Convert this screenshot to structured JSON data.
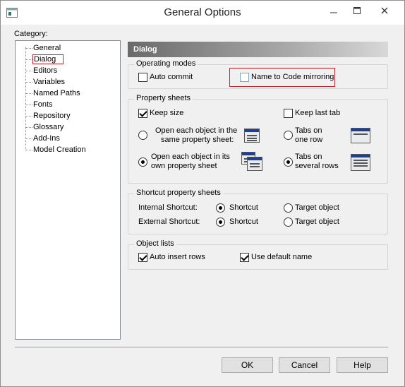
{
  "window": {
    "title": "General Options",
    "controls": {
      "minimize": "‒",
      "maximize": "☐",
      "close": "✕"
    }
  },
  "category": {
    "label": "Category:",
    "items": [
      "General",
      "Dialog",
      "Editors",
      "Variables",
      "Named Paths",
      "Fonts",
      "Repository",
      "Glossary",
      "Add-Ins",
      "Model Creation"
    ],
    "selected": "Dialog"
  },
  "panel": {
    "header": "Dialog",
    "operating_modes": {
      "title": "Operating modes",
      "auto_commit": {
        "label": "Auto commit",
        "checked": false
      },
      "name_to_code": {
        "label": "Name to Code mirroring",
        "checked": false
      }
    },
    "property_sheets": {
      "title": "Property sheets",
      "keep_size": {
        "label": "Keep size",
        "checked": true
      },
      "keep_last_tab": {
        "label": "Keep last tab",
        "checked": false
      },
      "open_same_line1": "Open each object in the",
      "open_same_line2": "same property sheet:",
      "open_own_line1": "Open each object in its",
      "open_own_line2": "own property sheet",
      "tabs_one_line1": "Tabs on",
      "tabs_one_line2": "one row",
      "tabs_several_line1": "Tabs on",
      "tabs_several_line2": "several rows"
    },
    "shortcut_sheets": {
      "title": "Shortcut property sheets",
      "internal_label": "Internal Shortcut:",
      "external_label": "External Shortcut:",
      "shortcut": "Shortcut",
      "target_object": "Target object"
    },
    "object_lists": {
      "title": "Object lists",
      "auto_insert": {
        "label": "Auto insert rows",
        "checked": true
      },
      "use_default": {
        "label": "Use default name",
        "checked": true
      }
    }
  },
  "buttons": {
    "ok": "OK",
    "cancel": "Cancel",
    "help": "Help"
  },
  "colors": {
    "highlight": "#d0202a",
    "header_dark": "#6a6a6a"
  }
}
